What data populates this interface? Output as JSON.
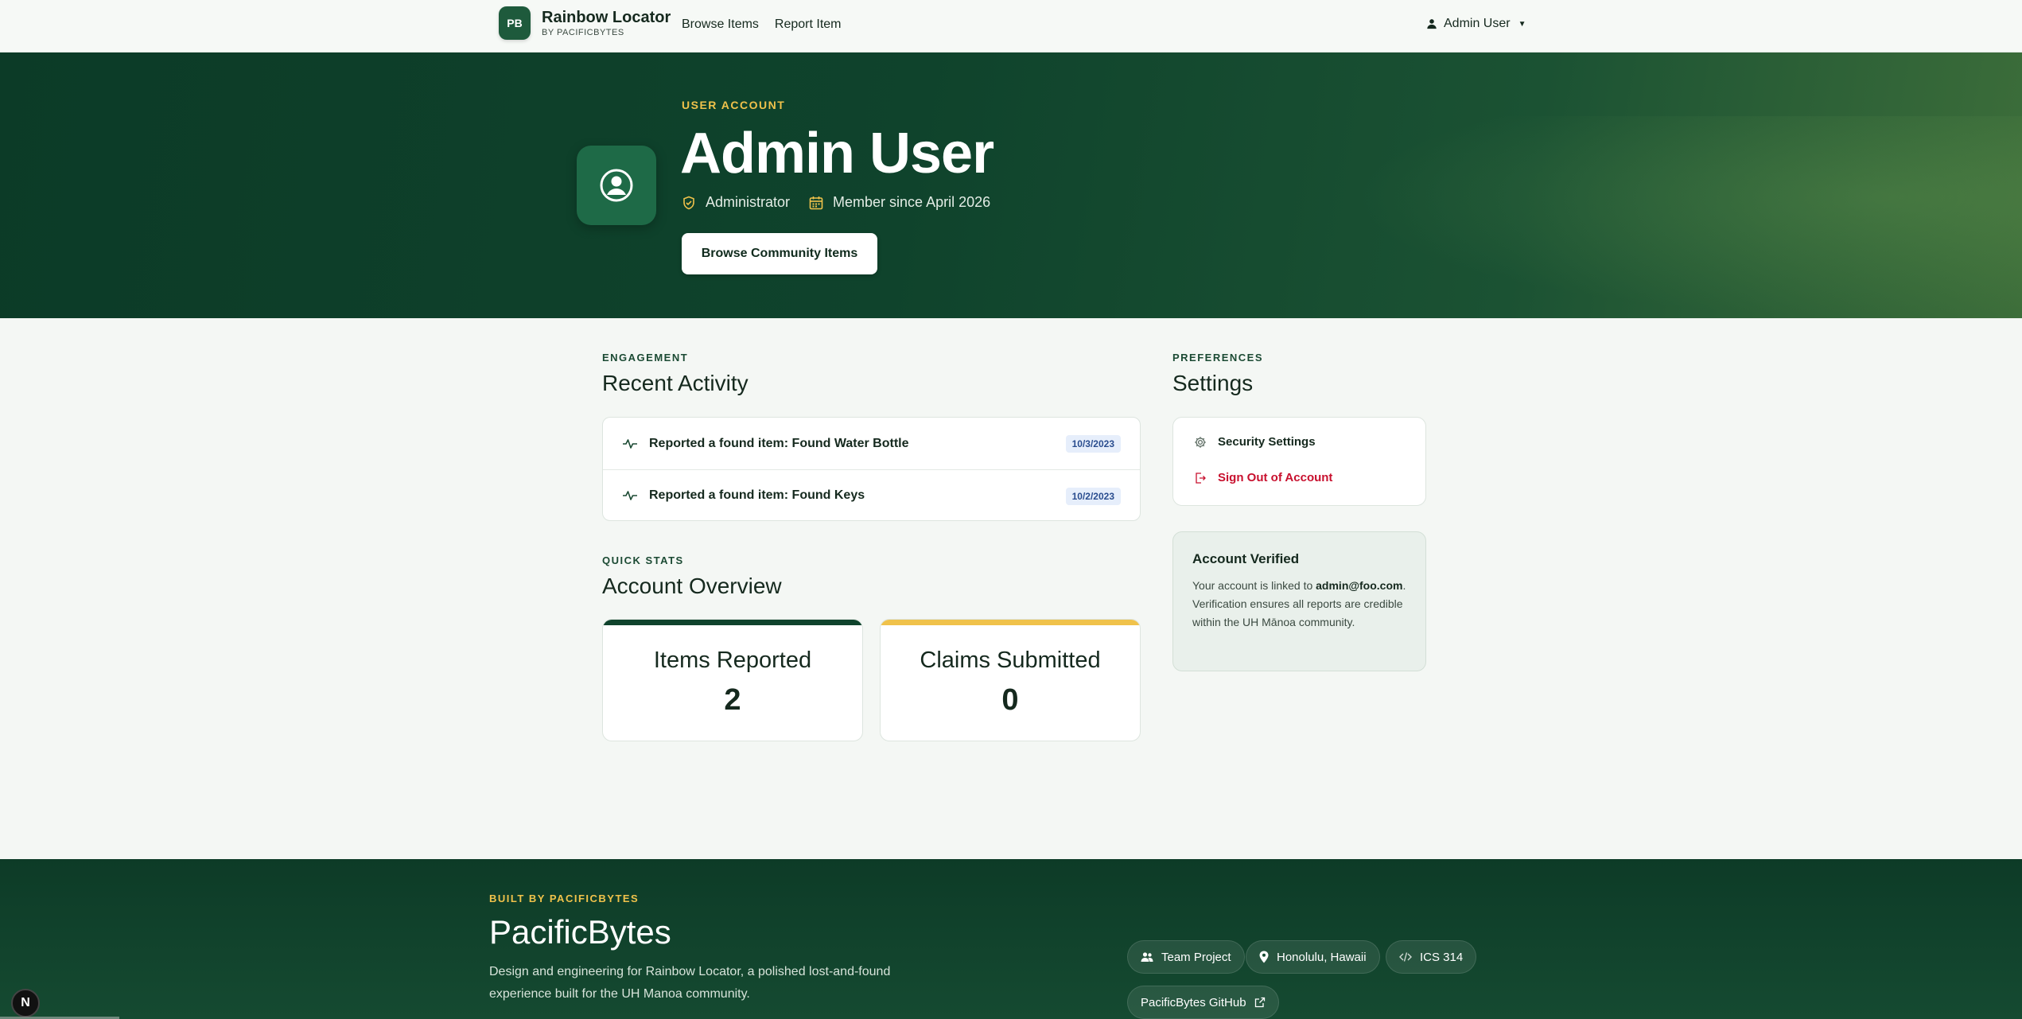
{
  "nav": {
    "brand_badge": "PB",
    "brand_title": "Rainbow Locator",
    "brand_sub": "BY PACIFICBYTES",
    "links": [
      "Browse Items",
      "Report Item"
    ],
    "user_menu": "Admin User"
  },
  "hero": {
    "eyebrow": "USER ACCOUNT",
    "name": "Admin User",
    "role": "Administrator",
    "member_since": "Member since April 2026",
    "button": "Browse Community Items"
  },
  "activity": {
    "eyebrow": "ENGAGEMENT",
    "title": "Recent Activity",
    "items": [
      {
        "text": "Reported a found item: Found Water Bottle",
        "date": "10/3/2023"
      },
      {
        "text": "Reported a found item: Found Keys",
        "date": "10/2/2023"
      }
    ]
  },
  "stats": {
    "eyebrow": "QUICK STATS",
    "title": "Account Overview",
    "cards": [
      {
        "label": "Items Reported",
        "value": "2",
        "accent": "#0f432c"
      },
      {
        "label": "Claims Submitted",
        "value": "0",
        "accent": "#f0c24b"
      }
    ]
  },
  "settings": {
    "eyebrow": "PREFERENCES",
    "title": "Settings",
    "security": "Security Settings",
    "sign_out": "Sign Out of Account",
    "verified_title": "Account Verified",
    "verified_prefix": "Your account is linked to ",
    "verified_email": "admin@foo.com",
    "verified_suffix": ". Verification ensures all reports are credible within the UH Mānoa community."
  },
  "footer": {
    "eyebrow": "BUILT BY PACIFICBYTES",
    "title": "PacificBytes",
    "desc": "Design and engineering for Rainbow Locator, a polished lost-and-found experience built for the UH Manoa community.",
    "chips": [
      "Team Project",
      "Honolulu, Hawaii",
      "ICS 314",
      "PacificBytes GitHub"
    ]
  },
  "dev_badge": "N",
  "colors": {
    "brand": "#0f432c",
    "gold": "#f0c24b",
    "danger": "#c8102e"
  }
}
